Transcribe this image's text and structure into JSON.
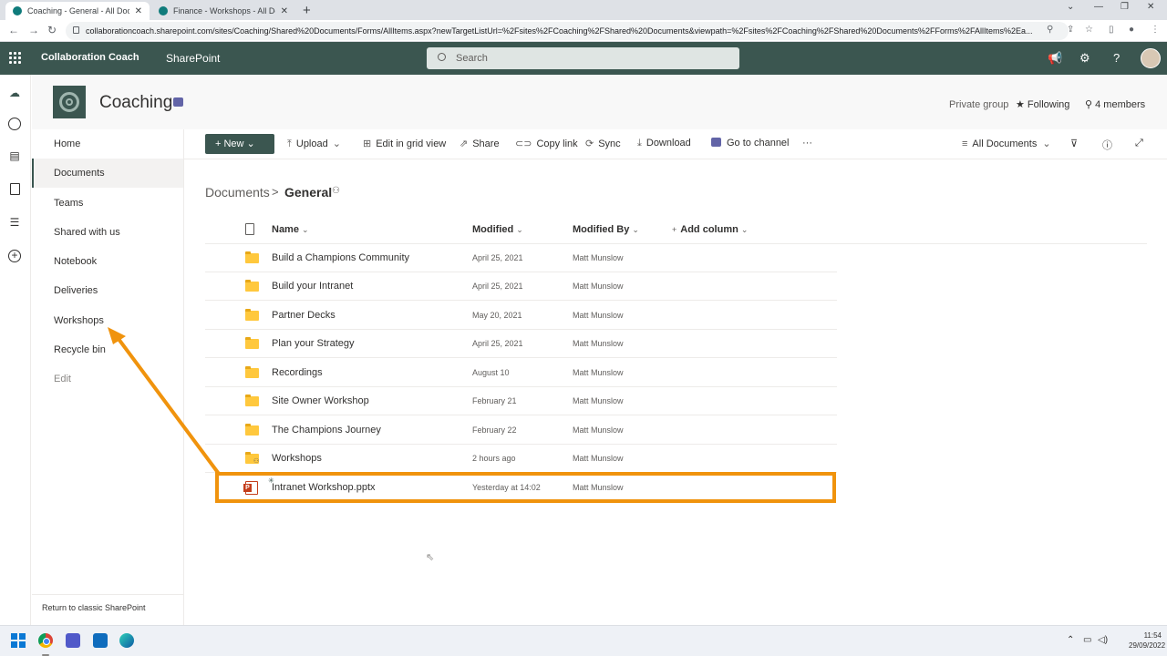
{
  "browser": {
    "tabs": [
      {
        "title": "Coaching - General - All Docume",
        "active": true
      },
      {
        "title": "Finance - Workshops - All Docum",
        "active": false
      }
    ],
    "new_tab": "+",
    "url": "collaborationcoach.sharepoint.com/sites/Coaching/Shared%20Documents/Forms/AllItems.aspx?newTargetListUrl=%2Fsites%2FCoaching%2FShared%20Documents&viewpath=%2Fsites%2FCoaching%2FShared%20Documents%2FForms%2FAllItems%2Ea..."
  },
  "suitebar": {
    "org": "Collaboration Coach",
    "app": "SharePoint",
    "search_placeholder": "Search",
    "bg_color": "#3b5650"
  },
  "site": {
    "title": "Coaching",
    "privacy": "Private group",
    "following": "Following",
    "members": "4 members"
  },
  "leftnav": {
    "items": [
      {
        "label": "Home"
      },
      {
        "label": "Documents",
        "selected": true
      },
      {
        "label": "Teams"
      },
      {
        "label": "Shared with us"
      },
      {
        "label": "Notebook"
      },
      {
        "label": "Deliveries"
      },
      {
        "label": "Workshops"
      },
      {
        "label": "Recycle bin"
      },
      {
        "label": "Edit"
      }
    ],
    "footer": "Return to classic SharePoint"
  },
  "commandbar": {
    "new": "New",
    "upload": "Upload",
    "edit_grid": "Edit in grid view",
    "share": "Share",
    "copy_link": "Copy link",
    "sync": "Sync",
    "download": "Download",
    "go_to_channel": "Go to channel",
    "more": "···",
    "view": "All Documents"
  },
  "breadcrumb": {
    "root": "Documents",
    "separator": ">",
    "current": "General"
  },
  "list": {
    "columns": {
      "name": "Name",
      "modified": "Modified",
      "modified_by": "Modified By",
      "add_column": "Add column"
    },
    "rows": [
      {
        "type": "folder",
        "name": "Build a Champions Community",
        "modified": "April 25, 2021",
        "modified_by": "Matt Munslow"
      },
      {
        "type": "folder",
        "name": "Build your Intranet",
        "modified": "April 25, 2021",
        "modified_by": "Matt Munslow"
      },
      {
        "type": "folder",
        "name": "Partner Decks",
        "modified": "May 20, 2021",
        "modified_by": "Matt Munslow"
      },
      {
        "type": "folder",
        "name": "Plan your Strategy",
        "modified": "April 25, 2021",
        "modified_by": "Matt Munslow"
      },
      {
        "type": "folder",
        "name": "Recordings",
        "modified": "August 10",
        "modified_by": "Matt Munslow"
      },
      {
        "type": "folder",
        "name": "Site Owner Workshop",
        "modified": "February 21",
        "modified_by": "Matt Munslow"
      },
      {
        "type": "folder",
        "name": "The Champions Journey",
        "modified": "February 22",
        "modified_by": "Matt Munslow"
      },
      {
        "type": "folder-shared",
        "name": "Workshops",
        "modified": "2 hours ago",
        "modified_by": "Matt Munslow"
      },
      {
        "type": "pptx",
        "name": "Intranet Workshop.pptx",
        "modified": "Yesterday at 14:02",
        "modified_by": "Matt Munslow"
      }
    ]
  },
  "annotation": {
    "color": "#f0930d"
  },
  "taskbar": {
    "time": "11:54",
    "date": "29/09/2022"
  }
}
